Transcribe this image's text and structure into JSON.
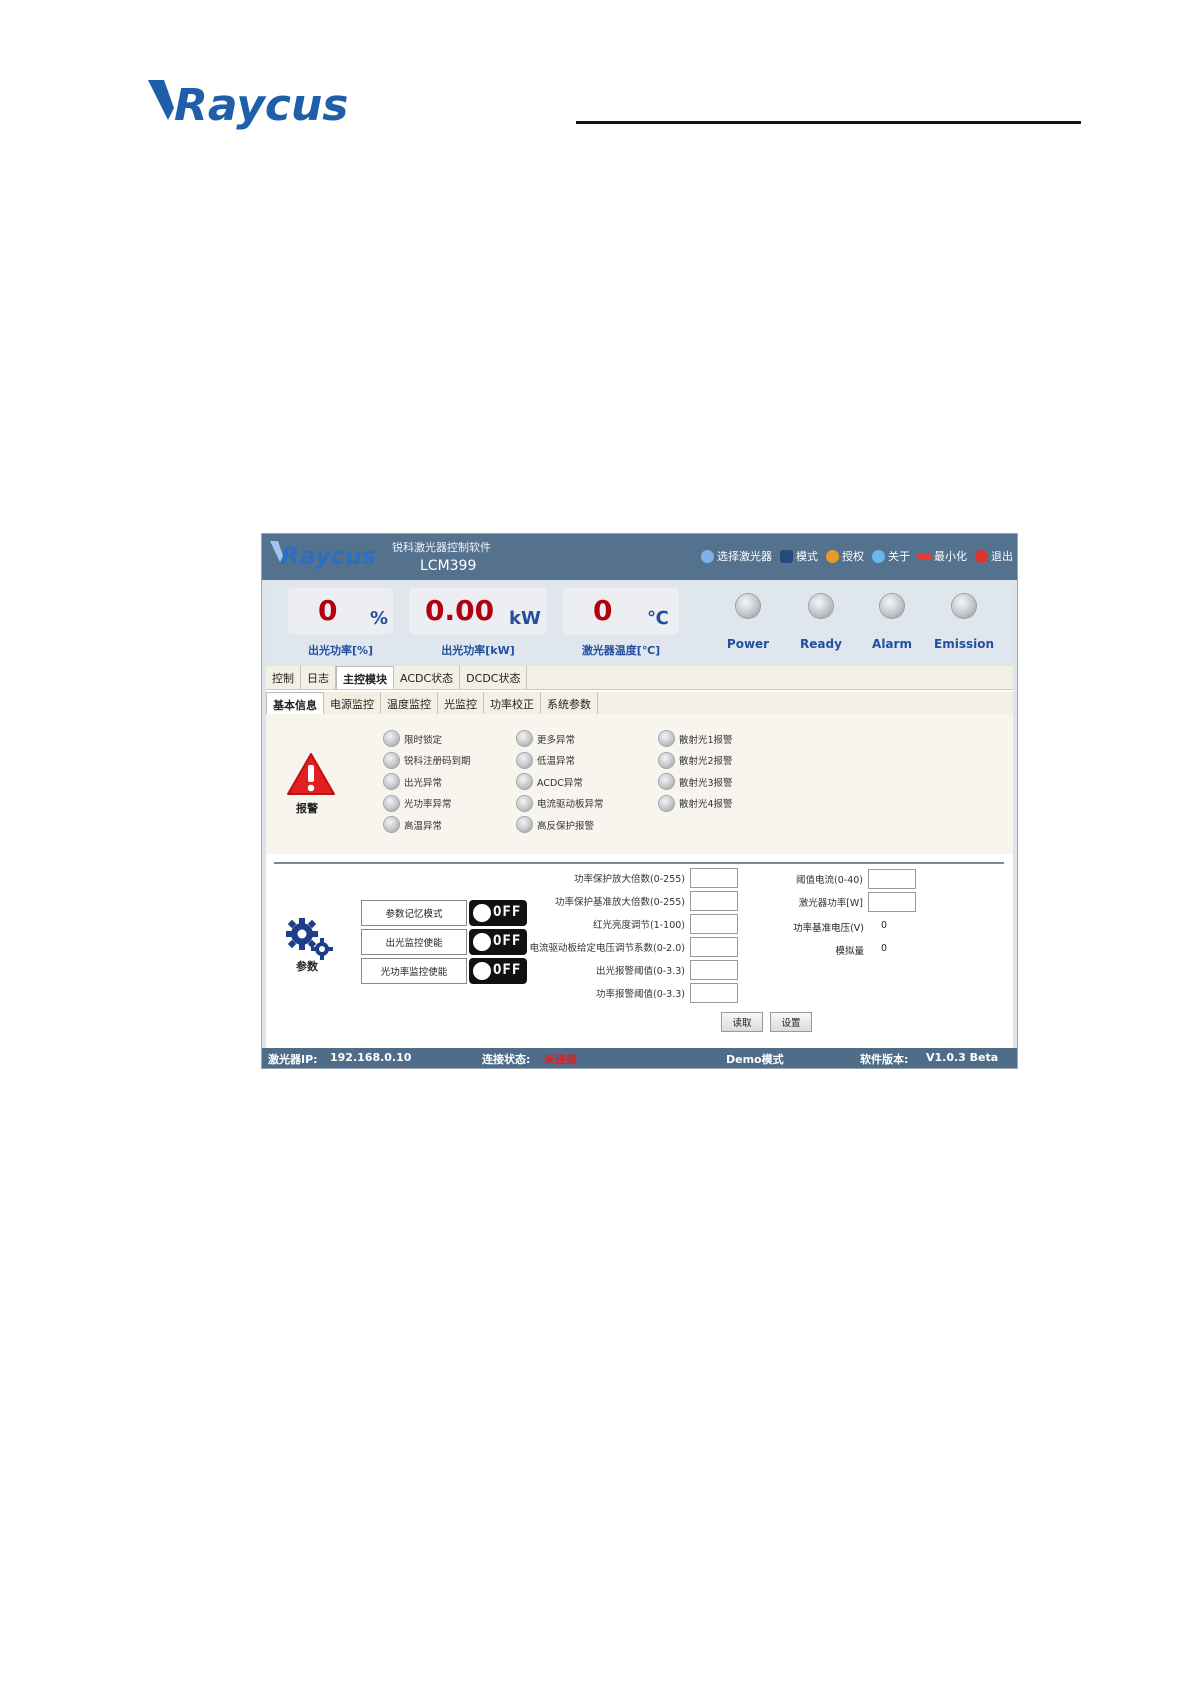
{
  "doc": {
    "brand": "Raycus"
  },
  "app": {
    "brand": "Raycus",
    "subtitle": "锐科激光器控制软件",
    "model": "LCM399",
    "menu": [
      {
        "label": "选择激光器",
        "icon": "laser-select-icon"
      },
      {
        "label": "模式",
        "icon": "users-icon"
      },
      {
        "label": "授权",
        "icon": "key-icon"
      },
      {
        "label": "关于",
        "icon": "info-icon"
      },
      {
        "label": "最小化",
        "icon": "minimize-icon"
      },
      {
        "label": "退出",
        "icon": "exit-icon"
      }
    ]
  },
  "readouts": [
    {
      "value": "0",
      "unit": "%",
      "label": "出光功率[%]"
    },
    {
      "value": "0.00",
      "unit": "kW",
      "label": "出光功率[kW]"
    },
    {
      "value": "0",
      "unit": "℃",
      "label": "激光器温度[℃]"
    }
  ],
  "lamps": [
    "Power",
    "Ready",
    "Alarm",
    "Emission"
  ],
  "tabs_main": [
    "控制",
    "日志",
    "主控模块",
    "ACDC状态",
    "DCDC状态"
  ],
  "tabs_sub": [
    "基本信息",
    "电源监控",
    "温度监控",
    "光监控",
    "功率校正",
    "系统参数"
  ],
  "alarm": {
    "label": "报警",
    "col1": [
      "限时锁定",
      "锐科注册码到期",
      "出光异常",
      "光功率异常",
      "高温异常"
    ],
    "col2": [
      "更多异常",
      "低温异常",
      "ACDC异常",
      "电流驱动板异常",
      "高反保护报警"
    ],
    "col3": [
      "散射光1报警",
      "散射光2报警",
      "散射光3报警",
      "散射光4报警"
    ]
  },
  "params": {
    "label": "参数",
    "toggles": [
      {
        "label": "参数记忆模式",
        "state": "OFF"
      },
      {
        "label": "出光监控使能",
        "state": "OFF"
      },
      {
        "label": "光功率监控使能",
        "state": "OFF"
      }
    ],
    "fields_mid": [
      "功率保护放大倍数(0-255)",
      "功率保护基准放大倍数(0-255)",
      "红光亮度调节(1-100)",
      "电流驱动板给定电压调节系数(0-2.0)",
      "出光报警阈值(0-3.3)",
      "功率报警阈值(0-3.3)"
    ],
    "fields_right": [
      "阈值电流(0-40)",
      "激光器功率[W]"
    ],
    "readonly": [
      {
        "label": "功率基准电压(V)",
        "value": "0"
      },
      {
        "label": "模拟量",
        "value": "0"
      }
    ],
    "read_button": "读取",
    "set_button": "设置"
  },
  "statusbar": {
    "ip_label": "激光器IP:",
    "ip_value": "192.168.0.10",
    "conn_label": "连接状态:",
    "conn_value": "未连接",
    "mode": "Demo模式",
    "ver_label": "软件版本:",
    "ver_value": "V1.0.3 Beta"
  },
  "colors": {
    "accent": "#244f9e",
    "value_red": "#b3000e",
    "titlebar": "#54718d",
    "alert_red": "#e21f1f"
  }
}
